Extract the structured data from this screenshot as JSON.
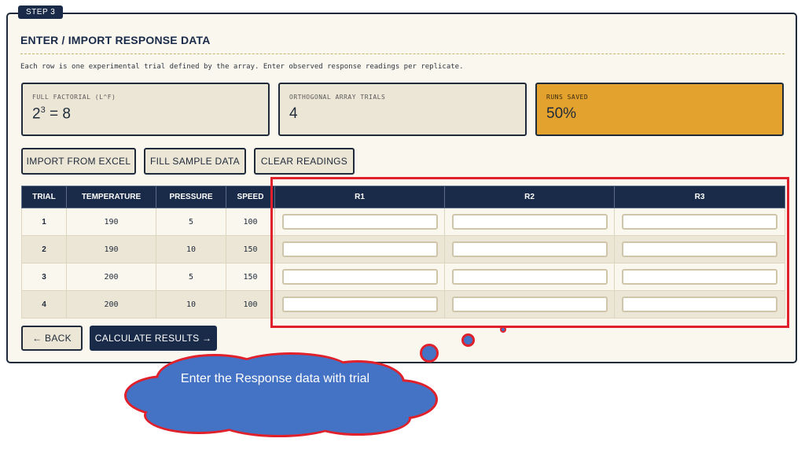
{
  "step": {
    "label": "STEP 3"
  },
  "header": {
    "title": "ENTER / IMPORT RESPONSE DATA",
    "description": "Each row is one experimental trial defined by the array. Enter observed response readings per replicate."
  },
  "stats": {
    "full_factorial": {
      "label": "FULL FACTORIAL (L^F)",
      "base": "2",
      "exponent": "3",
      "result": "= 8"
    },
    "orthogonal": {
      "label": "ORTHOGONAL ARRAY TRIALS",
      "value": "4"
    },
    "runs_saved": {
      "label": "RUNS SAVED",
      "value": "50%"
    }
  },
  "actions": {
    "import": "IMPORT FROM EXCEL",
    "fill": "FILL SAMPLE DATA",
    "clear": "CLEAR READINGS"
  },
  "table": {
    "headers": [
      "TRIAL",
      "TEMPERATURE",
      "PRESSURE",
      "SPEED",
      "R1",
      "R2",
      "R3"
    ],
    "rows": [
      {
        "trial": "1",
        "temperature": "190",
        "pressure": "5",
        "speed": "100"
      },
      {
        "trial": "2",
        "temperature": "190",
        "pressure": "10",
        "speed": "150"
      },
      {
        "trial": "3",
        "temperature": "200",
        "pressure": "5",
        "speed": "150"
      },
      {
        "trial": "4",
        "temperature": "200",
        "pressure": "10",
        "speed": "100"
      }
    ]
  },
  "nav": {
    "back": "← BACK",
    "calculate": "CALCULATE RESULTS →"
  },
  "annotation": {
    "text": "Enter the Response data with trial"
  },
  "colors": {
    "navy": "#1a2b4a",
    "accent": "#e3a22d",
    "highlight": "#e0202a",
    "cloud": "#4472c4"
  }
}
